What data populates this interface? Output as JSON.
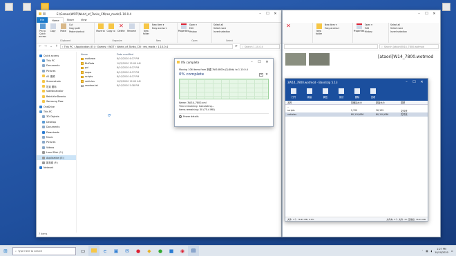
{
  "desktop": {
    "icons": [
      "",
      "",
      "",
      "",
      "",
      "",
      ""
    ]
  },
  "explorer": {
    "title": "E:\\Games\\WOT\\World_of_Tanks_CN\\res_mods\\1.10.0.4",
    "tabs": [
      "File",
      "Home",
      "Share",
      "View"
    ],
    "ribbon": {
      "clipboard": {
        "pin": "Pin to Quick access",
        "copy": "Copy",
        "paste": "Paste",
        "cut": "Cut",
        "copy_path": "Copy path",
        "paste_shortcut": "Paste shortcut",
        "group": "Clipboard"
      },
      "organize": {
        "move_to": "Move to",
        "copy_to": "Copy to",
        "delete": "Delete",
        "rename": "Rename",
        "group": "Organize"
      },
      "new": {
        "new_folder": "New folder",
        "new_item": "New item ▾",
        "easy_access": "Easy access ▾",
        "group": "New"
      },
      "open": {
        "properties": "Properties",
        "open": "Open ▾",
        "edit": "Edit",
        "history": "History",
        "group": "Open"
      },
      "select": {
        "select_all": "Select all",
        "select_none": "Select none",
        "invert": "Invert selection",
        "group": "Select"
      }
    },
    "address": "› This PC › Application (E:) › Games › WOT › World_of_Tanks_CN › res_mods › 1.10.0.4",
    "search_placeholder": "Search 1.10.0.4",
    "columns": {
      "name": "Name",
      "date": "Date modified"
    },
    "nav": [
      {
        "label": "Quick access",
        "sub": false,
        "color": "#2b7cd3"
      },
      {
        "label": "This PC",
        "sub": true,
        "color": "#5b9bd5"
      },
      {
        "label": "Documents",
        "sub": true,
        "color": "#8aa8c8"
      },
      {
        "label": "Pictures",
        "sub": true,
        "color": "#8aa8c8"
      },
      {
        "label": "A1 视频",
        "sub": true,
        "color": "#f6c646"
      },
      {
        "label": "Screenshots",
        "sub": true,
        "color": "#f6c646"
      },
      {
        "label": "坦克 图标",
        "sub": true,
        "color": "#f6c646"
      },
      {
        "label": "statisticalcalor",
        "sub": true,
        "color": "#f6c646"
      },
      {
        "label": "BaiduYunDownlo",
        "sub": true,
        "color": "#f6c646"
      },
      {
        "label": "Samsung Flow",
        "sub": true,
        "color": "#f6c646"
      },
      {
        "label": "OneDrive",
        "sub": false,
        "color": "#2b7cd3"
      },
      {
        "label": "This PC",
        "sub": false,
        "color": "#5b9bd5"
      },
      {
        "label": "3D Objects",
        "sub": true,
        "color": "#8aa8c8"
      },
      {
        "label": "Desktop",
        "sub": true,
        "color": "#5b9bd5"
      },
      {
        "label": "Documents",
        "sub": true,
        "color": "#8aa8c8"
      },
      {
        "label": "Downloads",
        "sub": true,
        "color": "#2b7cd3"
      },
      {
        "label": "Music",
        "sub": true,
        "color": "#8aa8c8"
      },
      {
        "label": "Pictures",
        "sub": true,
        "color": "#8aa8c8"
      },
      {
        "label": "Videos",
        "sub": true,
        "color": "#8aa8c8"
      },
      {
        "label": "Local Disk (C:)",
        "sub": true,
        "color": "#999999"
      },
      {
        "label": "Application (E:)",
        "sub": true,
        "color": "#999999",
        "selected": true
      },
      {
        "label": "新加卷 (F:)",
        "sub": true,
        "color": "#999999"
      },
      {
        "label": "Network",
        "sub": false,
        "color": "#2b7cd3"
      }
    ],
    "files": [
      {
        "name": "audioww",
        "date": "8/10/2020 6:37 PM",
        "type": "folder"
      },
      {
        "name": "BixData",
        "date": "10/2/2020 12:00 AM",
        "type": "folder"
      },
      {
        "name": "gui",
        "date": "8/10/2020 6:37 PM",
        "type": "folder"
      },
      {
        "name": "maps",
        "date": "8/10/2020 6:37 PM",
        "type": "folder"
      },
      {
        "name": "scripts",
        "date": "8/10/2020 6:37 PM",
        "type": "folder"
      },
      {
        "name": "vehicles",
        "date": "10/2/2020 12:00 AM",
        "type": "folder"
      },
      {
        "name": "readme.txt",
        "date": "8/10/2020 5:38 PM",
        "type": "text"
      }
    ],
    "status": "7 items"
  },
  "progress": {
    "title": "0% complete",
    "moving_line": "Moving 106 items from 新建 3W14800u(2)(8kb) to 1.10.0.4",
    "headline": "0% complete",
    "name_line": "Name: 3W14_7800.xml",
    "time_line": "Time remaining: Calculating...",
    "items_line": "Items remaining: 30 (75.4 MB)",
    "fewer": "Fewer details"
  },
  "right_explorer": {
    "title": "[ataori]W14_7800.wotmod",
    "ribbon_items": [
      "New item ▾",
      "Easy access ▾",
      "Open ▾",
      "Edit",
      "History",
      "Select all",
      "Select none",
      "Invert selection"
    ],
    "new_folder": "New folder",
    "properties": "Properties",
    "search_placeholder": "Search [ataori]W14_7800.wotmod"
  },
  "archive": {
    "title": "3W14_7800.wotmod - Bandizip 5.13",
    "tools": [
      "打开",
      "新建",
      "解压",
      "测试",
      "删除",
      "查看"
    ],
    "cols": [
      "名称",
      "压缩后大小",
      "原始大小",
      "类型"
    ],
    "rows": [
      {
        "name": "..",
        "csize": "",
        "osize": "",
        "type": ""
      },
      {
        "name": "scripts",
        "csize": "2,700",
        "osize": "36,139",
        "type": "文件夹"
      },
      {
        "name": "vehicles",
        "csize": "80,110,636",
        "osize": "80,110,636",
        "type": "文件夹"
      }
    ],
    "status_left": "文件: 1个, 76.45 MB, 0.0%",
    "status_right": "文件夹: 3个, 文件: 15, 压缩后: 76.45 MB"
  },
  "taskbar": {
    "search_placeholder": "Type here to search",
    "time": "1:27 PM",
    "date": "10/10/2020"
  }
}
